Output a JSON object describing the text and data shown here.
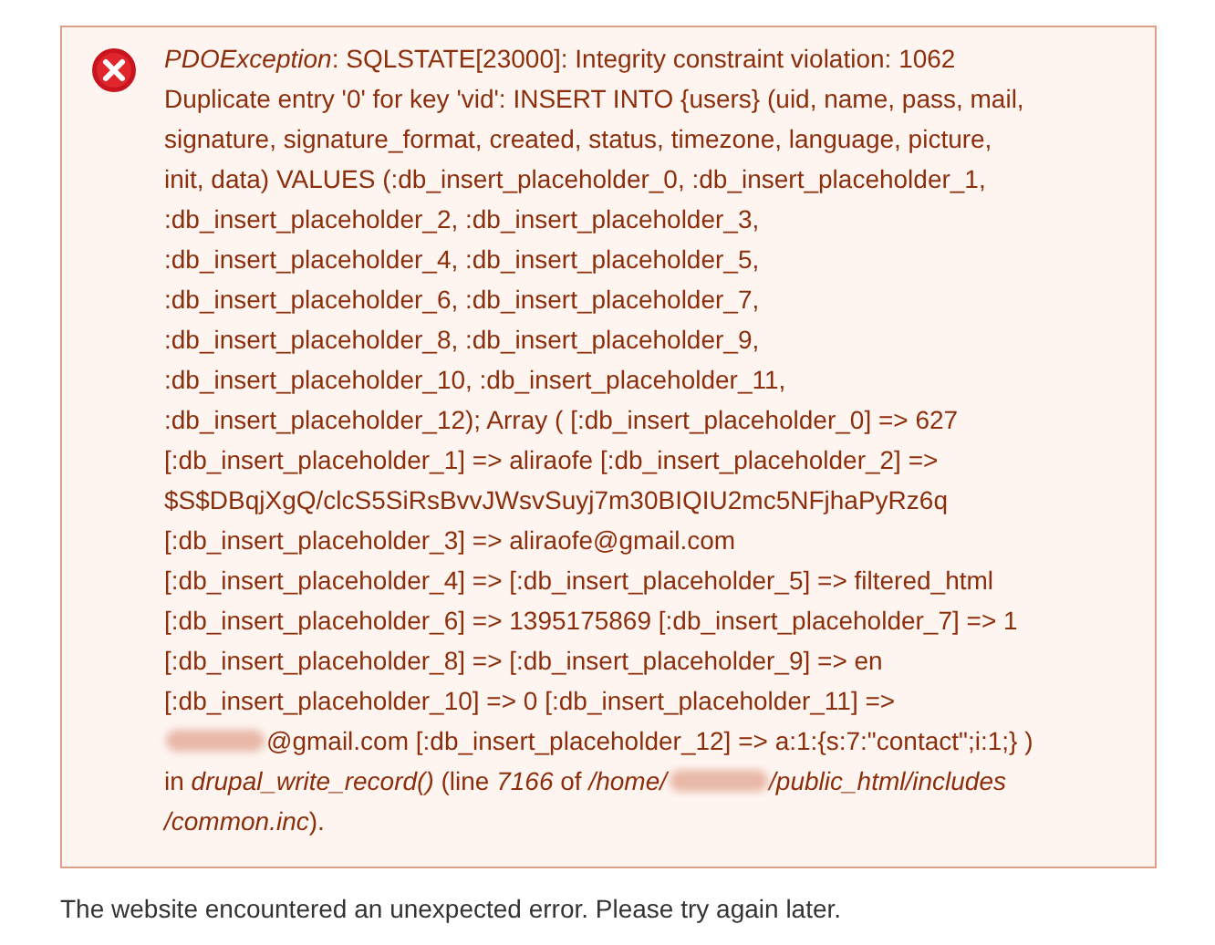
{
  "error": {
    "kind": "error",
    "lines": [
      [
        {
          "kind": "text",
          "text": "*PDOException*: SQLSTATE[23000]: Integrity constraint violation: 1062"
        }
      ],
      [
        {
          "kind": "text",
          "text": "Duplicate entry '0' for key 'vid': INSERT INTO {users} (uid, name, pass, mail,"
        }
      ],
      [
        {
          "kind": "text",
          "text": "signature, signature_format, created, status, timezone, language, picture,"
        }
      ],
      [
        {
          "kind": "text",
          "text": "init, data) VALUES (:db_insert_placeholder_0, :db_insert_placeholder_1,"
        }
      ],
      [
        {
          "kind": "text",
          "text": ":db_insert_placeholder_2, :db_insert_placeholder_3,"
        }
      ],
      [
        {
          "kind": "text",
          "text": ":db_insert_placeholder_4, :db_insert_placeholder_5,"
        }
      ],
      [
        {
          "kind": "text",
          "text": ":db_insert_placeholder_6, :db_insert_placeholder_7,"
        }
      ],
      [
        {
          "kind": "text",
          "text": ":db_insert_placeholder_8, :db_insert_placeholder_9,"
        }
      ],
      [
        {
          "kind": "text",
          "text": ":db_insert_placeholder_10, :db_insert_placeholder_11,"
        }
      ],
      [
        {
          "kind": "text",
          "text": ":db_insert_placeholder_12); Array ( [:db_insert_placeholder_0] => 627"
        }
      ],
      [
        {
          "kind": "text",
          "text": "[:db_insert_placeholder_1] => aliraofe [:db_insert_placeholder_2] =>"
        }
      ],
      [
        {
          "kind": "text",
          "text": "$S$DBqjXgQ/clcS5SiRsBvvJWsvSuyj7m30BIQIU2mc5NFjhaPyRz6q"
        }
      ],
      [
        {
          "kind": "text",
          "text": "[:db_insert_placeholder_3] => aliraofe@gmail.com"
        }
      ],
      [
        {
          "kind": "text",
          "text": "[:db_insert_placeholder_4] => [:db_insert_placeholder_5] => filtered_html"
        }
      ],
      [
        {
          "kind": "text",
          "text": "[:db_insert_placeholder_6] => 1395175869 [:db_insert_placeholder_7] => 1"
        }
      ],
      [
        {
          "kind": "text",
          "text": "[:db_insert_placeholder_8] => [:db_insert_placeholder_9] => en"
        }
      ],
      [
        {
          "kind": "text",
          "text": "[:db_insert_placeholder_10] => 0 [:db_insert_placeholder_11] =>"
        }
      ],
      [
        {
          "kind": "redacted"
        },
        {
          "kind": "text",
          "text": "@gmail.com [:db_insert_placeholder_12] => a:1:{s:7:\"contact\";i:1;} )"
        }
      ],
      [
        {
          "kind": "text",
          "text": "in *drupal_write_record()* (line *7166* of */home/*"
        },
        {
          "kind": "redacted"
        },
        {
          "kind": "text",
          "text": "*/public_html/includes*"
        }
      ],
      [
        {
          "kind": "text",
          "text": "*/common.inc*)."
        }
      ]
    ]
  },
  "footer": "The website encountered an unexpected error. Please try again later."
}
